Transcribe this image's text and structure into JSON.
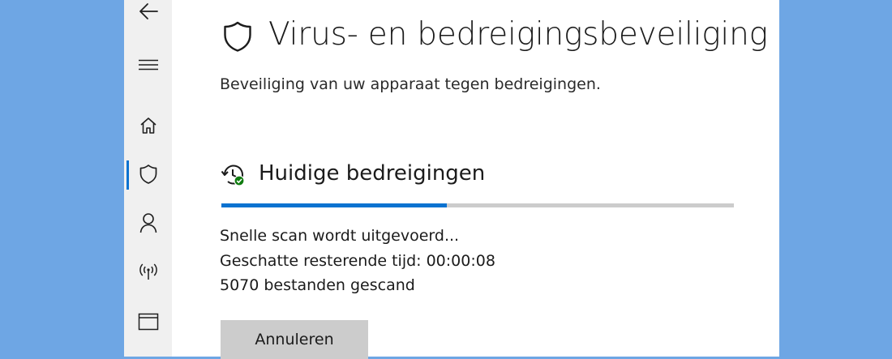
{
  "window": {
    "background_color": "#6ea6e4",
    "sidebar_color": "#f0f0f0",
    "accent_color": "#0a72d0"
  },
  "sidebar": {
    "items": [
      {
        "name": "back",
        "icon": "back-arrow-icon"
      },
      {
        "name": "menu",
        "icon": "hamburger-menu-icon"
      },
      {
        "name": "home",
        "icon": "home-icon"
      },
      {
        "name": "virus-protection",
        "icon": "shield-icon",
        "active": true
      },
      {
        "name": "account-protection",
        "icon": "person-icon"
      },
      {
        "name": "firewall-network",
        "icon": "wireless-signal-icon"
      },
      {
        "name": "app-browser-control",
        "icon": "app-window-icon"
      }
    ]
  },
  "header": {
    "title": "Virus- en bedreigingsbeveiliging",
    "title_icon": "shield-outline-icon",
    "subtitle": "Beveiliging van uw apparaat tegen bedreigingen."
  },
  "threats": {
    "title": "Huidige bedreigingen",
    "title_icon": "scan-history-check-icon",
    "progress_fraction": 0.44,
    "status": "Snelle scan wordt uitgevoerd...",
    "remaining_label": "Geschatte resterende tijd:",
    "remaining_value": "00:00:08",
    "scanned_count": "5070",
    "scanned_label": "bestanden gescand",
    "cancel_label": "Annuleren"
  }
}
